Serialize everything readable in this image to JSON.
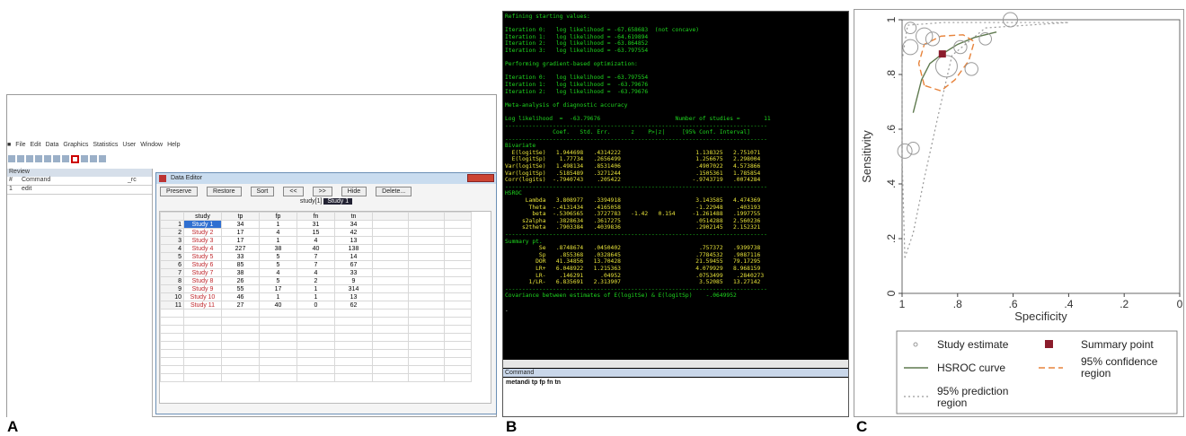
{
  "panel_labels": [
    "A",
    "B",
    "C"
  ],
  "panel_a": {
    "menu": [
      "File",
      "Edit",
      "Data",
      "Graphics",
      "Statistics",
      "User",
      "Window",
      "Help"
    ],
    "review": {
      "title": "Review",
      "col_num": "#",
      "col_cmd": "Command",
      "col_rc": "_rc",
      "rows": [
        {
          "num": "1",
          "cmd": "edit"
        }
      ]
    },
    "editor": {
      "title": "Data Editor",
      "buttons": [
        "Preserve",
        "Restore",
        "Sort",
        "<<",
        ">>",
        "Hide",
        "Delete..."
      ],
      "var_row": "study[1]",
      "var_value": "Study 1",
      "columns": [
        "study",
        "tp",
        "fp",
        "fn",
        "tn"
      ],
      "rows": [
        [
          "1",
          "Study 1",
          "34",
          "1",
          "31",
          "34"
        ],
        [
          "2",
          "Study 2",
          "17",
          "4",
          "15",
          "42"
        ],
        [
          "3",
          "Study 3",
          "17",
          "1",
          "4",
          "13"
        ],
        [
          "4",
          "Study 4",
          "227",
          "38",
          "40",
          "138"
        ],
        [
          "5",
          "Study 5",
          "33",
          "5",
          "7",
          "14"
        ],
        [
          "6",
          "Study 6",
          "85",
          "5",
          "7",
          "67"
        ],
        [
          "7",
          "Study 7",
          "38",
          "4",
          "4",
          "33"
        ],
        [
          "8",
          "Study 8",
          "26",
          "5",
          "2",
          "9"
        ],
        [
          "9",
          "Study 9",
          "55",
          "17",
          "1",
          "314"
        ],
        [
          "10",
          "Study 10",
          "46",
          "1",
          "1",
          "13"
        ],
        [
          "11",
          "Study 11",
          "27",
          "40",
          "0",
          "62"
        ]
      ]
    }
  },
  "panel_b": {
    "lines": [
      {
        "t": "Refining starting values:",
        "c": "g"
      },
      {
        "t": "",
        "c": "g"
      },
      {
        "t": "Iteration 0:   log likelihood = -67.658683  (not concave)",
        "c": "g"
      },
      {
        "t": "Iteration 1:   log likelihood = -64.619894",
        "c": "g"
      },
      {
        "t": "Iteration 2:   log likelihood = -63.864852",
        "c": "g"
      },
      {
        "t": "Iteration 3:   log likelihood = -63.797554",
        "c": "g"
      },
      {
        "t": "",
        "c": "g"
      },
      {
        "t": "Performing gradient-based optimization:",
        "c": "g"
      },
      {
        "t": "",
        "c": "g"
      },
      {
        "t": "Iteration 0:   log likelihood = -63.797554",
        "c": "g"
      },
      {
        "t": "Iteration 1:   log likelihood =  -63.79676",
        "c": "g"
      },
      {
        "t": "Iteration 2:   log likelihood =  -63.79676",
        "c": "g"
      },
      {
        "t": "",
        "c": "g"
      },
      {
        "t": "Meta-analysis of diagnostic accuracy",
        "c": "g"
      },
      {
        "t": "",
        "c": "g"
      },
      {
        "t": "Log likelihood  =  -63.79676                      Number of studies =       11",
        "c": "g"
      },
      {
        "t": "-----------------------------------------------------------------------------",
        "c": "g"
      },
      {
        "t": "              Coef.   Std. Err.      z    P>|z|     [95% Conf. Interval]",
        "c": "g"
      },
      {
        "t": "-----------------------------------------------------------------------------",
        "c": "g"
      },
      {
        "t": "Bivariate",
        "c": "g"
      },
      {
        "t": "  E(logitSe)   1.944698   .4314222                      1.138325   2.751071",
        "c": "y"
      },
      {
        "t": "  E(logitSp)    1.77734   .2656499                      1.256675   2.298004",
        "c": "y"
      },
      {
        "t": "Var(logitSe)   1.498134   .8531406                      .4907022   4.573866",
        "c": "y"
      },
      {
        "t": "Var(logitSp)   .5185489   .3271244                      .1505361   1.785854",
        "c": "y"
      },
      {
        "t": "Corr(logits)  -.7940743    .205422                     -.9743719   .0074284",
        "c": "y"
      },
      {
        "t": "-----------------------------------------------------------------------------",
        "c": "g"
      },
      {
        "t": "HSROC",
        "c": "g"
      },
      {
        "t": "      Lambda   3.808977   .3394918                      3.143585   4.474369",
        "c": "y"
      },
      {
        "t": "       Theta  -.4131434   .4165058                      -1.22948    .403193",
        "c": "y"
      },
      {
        "t": "        beta  -.5306565   .3727783   -1.42   0.154     -1.261488   .1997755",
        "c": "y"
      },
      {
        "t": "     s2alpha   .3828634   .3617275                      .0514288   2.560236",
        "c": "y"
      },
      {
        "t": "     s2theta   .7903384   .4039836                      .2902145   2.152321",
        "c": "y"
      },
      {
        "t": "-----------------------------------------------------------------------------",
        "c": "g"
      },
      {
        "t": "Summary pt.",
        "c": "g"
      },
      {
        "t": "          Se   .8748674   .0450402                       .757372   .9399738",
        "c": "y"
      },
      {
        "t": "          Sp    .855368   .0328645                      .7784532   .9087116",
        "c": "y"
      },
      {
        "t": "         DOR   41.34856   13.70428                      21.59455   79.17295",
        "c": "y"
      },
      {
        "t": "         LR+   6.048922   1.215363                      4.079929   8.968159",
        "c": "y"
      },
      {
        "t": "         LR-    .146291     .04952                      .0753499    .2840273",
        "c": "y"
      },
      {
        "t": "       1/LR-   6.835691   2.313907                       3.52085   13.27142",
        "c": "y"
      },
      {
        "t": "-----------------------------------------------------------------------------",
        "c": "g"
      },
      {
        "t": "Covariance between estimates of E(logitSe) & E(logitSp)    -.0649952",
        "c": "g"
      },
      {
        "t": "",
        "c": "g"
      },
      {
        "t": ".",
        "c": "w"
      }
    ],
    "command_title": "Command",
    "command_text": "metandi tp fp fn tn"
  },
  "chart_data": {
    "type": "scatter",
    "xlabel": "Specificity",
    "ylabel": "Sensitivity",
    "xlim": [
      1,
      0
    ],
    "ylim": [
      0,
      1
    ],
    "x_reversed": true,
    "xticks": [
      "1",
      ".8",
      ".6",
      ".4",
      ".2",
      "0"
    ],
    "yticks": [
      "0",
      ".2",
      ".4",
      ".6",
      ".8",
      "1"
    ],
    "grid": false,
    "legend_position": "bottom",
    "series": [
      {
        "name": "Study estimate",
        "kind": "points",
        "points": [
          {
            "sp": 0.97,
            "se": 0.97,
            "w": 0.6
          },
          {
            "sp": 0.97,
            "se": 0.9,
            "w": 1.1
          },
          {
            "sp": 0.92,
            "se": 0.94,
            "w": 1.3
          },
          {
            "sp": 0.89,
            "se": 0.93,
            "w": 0.9
          },
          {
            "sp": 0.79,
            "se": 0.9,
            "w": 0.8
          },
          {
            "sp": 0.61,
            "se": 1.0,
            "w": 1.0
          },
          {
            "sp": 0.7,
            "se": 0.93,
            "w": 0.7
          },
          {
            "sp": 0.84,
            "se": 0.83,
            "w": 2.0
          },
          {
            "sp": 0.75,
            "se": 0.82,
            "w": 0.8
          },
          {
            "sp": 0.96,
            "se": 0.53,
            "w": 0.7
          },
          {
            "sp": 0.99,
            "se": 0.52,
            "w": 1.0
          }
        ]
      },
      {
        "name": "Summary point",
        "kind": "summary",
        "sp": 0.855,
        "se": 0.875
      },
      {
        "name": "HSROC curve",
        "kind": "curve",
        "points": [
          {
            "sp": 0.96,
            "se": 0.66
          },
          {
            "sp": 0.93,
            "se": 0.78
          },
          {
            "sp": 0.9,
            "se": 0.84
          },
          {
            "sp": 0.855,
            "se": 0.875
          },
          {
            "sp": 0.8,
            "se": 0.91
          },
          {
            "sp": 0.74,
            "se": 0.935
          },
          {
            "sp": 0.66,
            "se": 0.955
          }
        ]
      },
      {
        "name": "95% confidence region",
        "kind": "conf",
        "points": [
          {
            "sp": 0.92,
            "se": 0.76
          },
          {
            "sp": 0.94,
            "se": 0.84
          },
          {
            "sp": 0.92,
            "se": 0.91
          },
          {
            "sp": 0.86,
            "se": 0.94
          },
          {
            "sp": 0.78,
            "se": 0.945
          },
          {
            "sp": 0.74,
            "se": 0.92
          },
          {
            "sp": 0.76,
            "se": 0.85
          },
          {
            "sp": 0.81,
            "se": 0.78
          },
          {
            "sp": 0.86,
            "se": 0.74
          },
          {
            "sp": 0.92,
            "se": 0.76
          }
        ]
      },
      {
        "name": "95% prediction region",
        "kind": "pred",
        "points": [
          {
            "sp": 0.99,
            "se": 0.13
          },
          {
            "sp": 1.0,
            "se": 0.5
          },
          {
            "sp": 1.0,
            "se": 0.85
          },
          {
            "sp": 0.98,
            "se": 0.98
          },
          {
            "sp": 0.85,
            "se": 0.99
          },
          {
            "sp": 0.62,
            "se": 0.99
          },
          {
            "sp": 0.4,
            "se": 0.99
          },
          {
            "sp": 0.7,
            "se": 0.97
          },
          {
            "sp": 0.82,
            "se": 0.87
          },
          {
            "sp": 0.87,
            "se": 0.65
          },
          {
            "sp": 0.92,
            "se": 0.42
          },
          {
            "sp": 0.96,
            "se": 0.22
          },
          {
            "sp": 0.99,
            "se": 0.13
          }
        ]
      }
    ],
    "legend": [
      "Study estimate",
      "Summary point",
      "HSROC curve",
      "95% confidence\nregion",
      "95% prediction\nregion"
    ],
    "colors": {
      "study": "#999999",
      "summary": "#8b1c2c",
      "hsroc": "#5f7a4f",
      "conf": "#e7833b",
      "pred": "#999999"
    }
  }
}
